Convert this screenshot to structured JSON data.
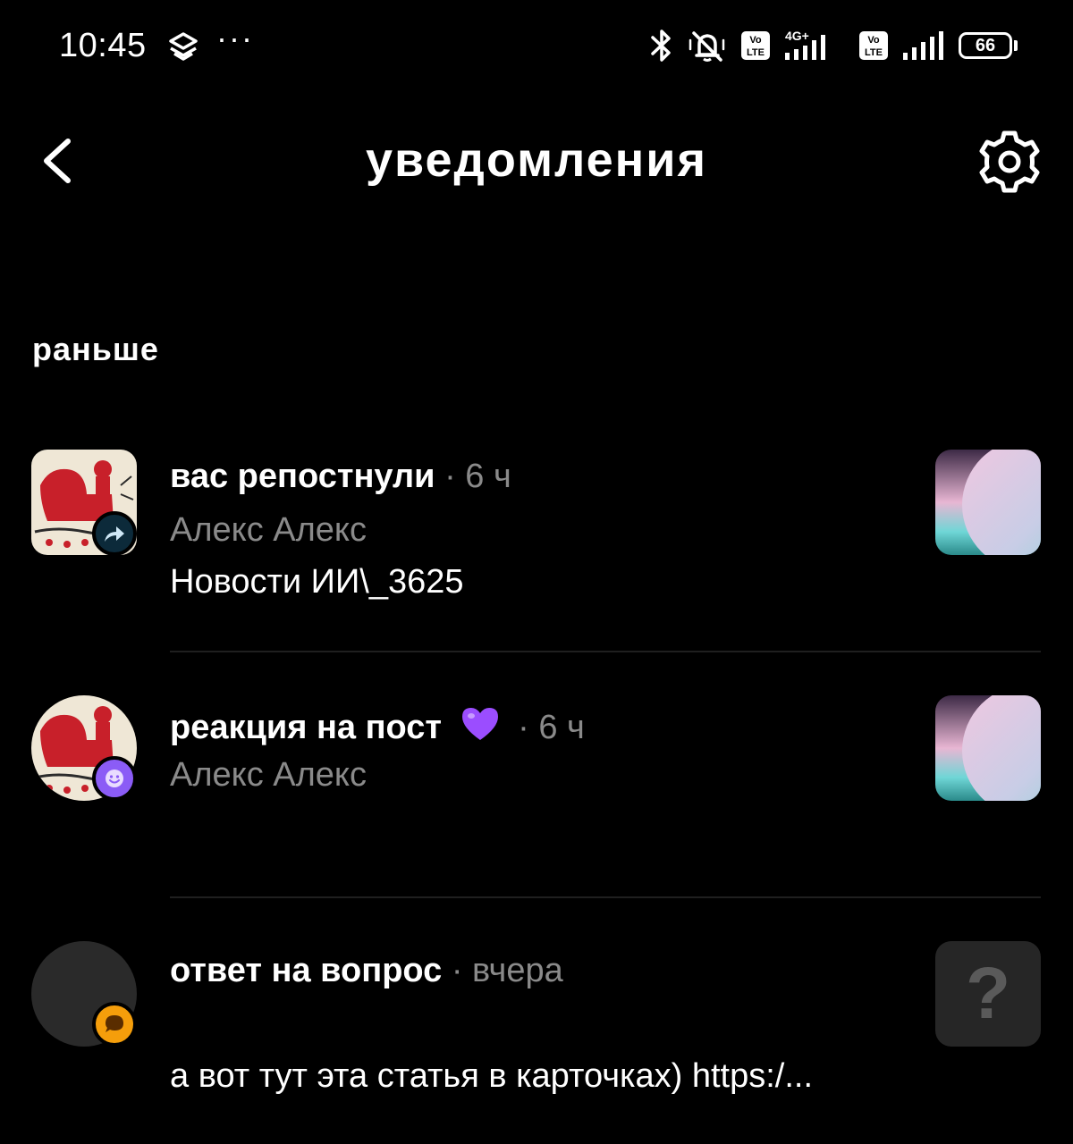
{
  "status_bar": {
    "time": "10:45",
    "more": "···",
    "battery": "66",
    "network_label": "4G+",
    "volte_1": "Vo LTE",
    "volte_2": "Vo LTE"
  },
  "header": {
    "title": "уведомления",
    "back_icon": "chevron-left-icon",
    "settings_icon": "gear-icon"
  },
  "section": {
    "title": "раньше"
  },
  "notifications": [
    {
      "title": "вас репостнули",
      "time": "· 6 ч",
      "author": "Алекс Алекс",
      "body": "Новости ИИ\\_3625",
      "badge_icon": "repost-arrow-icon",
      "badge_color": "#0c2a3a"
    },
    {
      "title": "реакция на пост",
      "reaction": "purple-heart-icon",
      "time": "· 6 ч",
      "author": "Алекс Алекс",
      "badge_icon": "smile-icon",
      "badge_color": "#8b5cf6"
    },
    {
      "title": "ответ на вопрос",
      "time": "· вчера",
      "body": "а вот тут эта статья в карточках) https:/...",
      "badge_icon": "speech-bubble-icon",
      "badge_color": "#f59e0b",
      "thumb_symbol": "?"
    }
  ],
  "colors": {
    "background": "#000000",
    "muted_text": "#8a8a8a",
    "divider": "#1f1f1f"
  }
}
